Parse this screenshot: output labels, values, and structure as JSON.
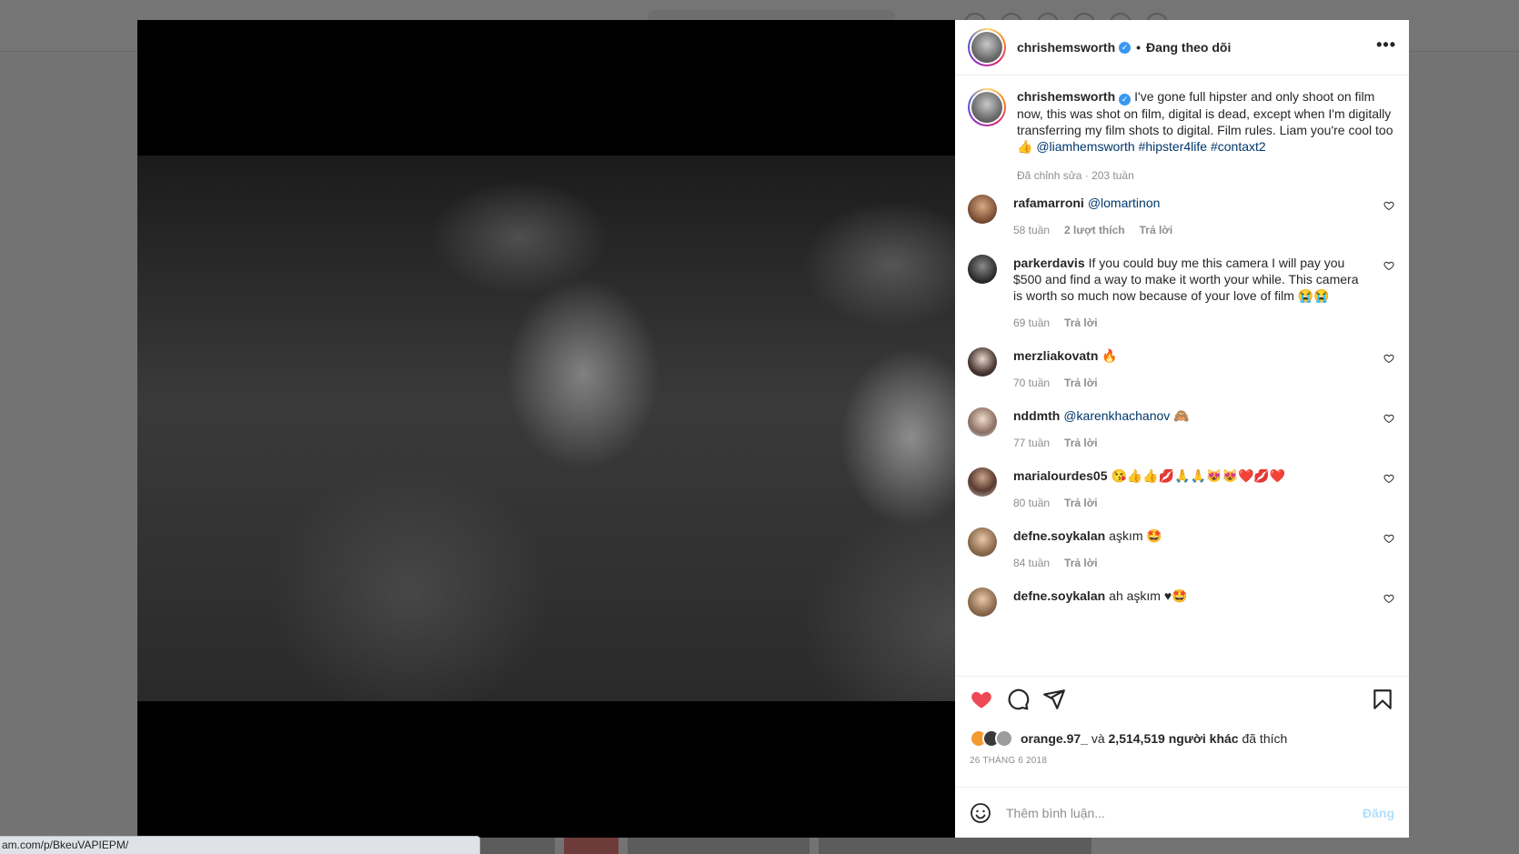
{
  "status_bar": {
    "url": "am.com/p/BkeuVAPIEPM/"
  },
  "post": {
    "author": "chrishemsworth",
    "follow_state": "Đang theo dõi",
    "separator": "•",
    "more": "•••",
    "caption": {
      "text": "I've gone full hipster and only shoot on film now, this was shot on film, digital is dead, except when I'm digitally transferring my film shots to digital. Film rules. Liam you're cool too 👍",
      "mention": "@liamhemsworth",
      "tags": "#hipster4life #contaxt2",
      "meta": "Đã chỉnh sửa · 203 tuần"
    },
    "reply_label": "Trả lời",
    "comments": [
      {
        "user": "rafamarroni",
        "link": "@lomartinon",
        "text": "",
        "time": "58 tuần",
        "likes": "2 lượt thích"
      },
      {
        "user": "parkerdavis",
        "link": "",
        "text": "If you could buy me this camera I will pay you $500 and find a way to make it worth your while. This camera is worth so much now because of your love of film 😭😭",
        "time": "69 tuần",
        "likes": ""
      },
      {
        "user": "merzliakovatn",
        "link": "",
        "text": "🔥",
        "time": "70 tuần",
        "likes": ""
      },
      {
        "user": "nddmth",
        "link": "@karenkhachanov",
        "text": "🙈",
        "time": "77 tuần",
        "likes": ""
      },
      {
        "user": "marialourdes05",
        "link": "",
        "text": "😘👍👍💋🙏🙏😻😻❤️💋❤️",
        "time": "80 tuần",
        "likes": ""
      },
      {
        "user": "defne.soykalan",
        "link": "",
        "text": "aşkım 🤩",
        "time": "84 tuần",
        "likes": ""
      },
      {
        "user": "defne.soykalan",
        "link": "",
        "text": "ah aşkım ♥🤩",
        "time": "",
        "likes": ""
      }
    ],
    "likes_line": {
      "first_liker": "orange.97_",
      "conjunction": "và",
      "others": "2,514,519 người khác",
      "suffix": "đã thích"
    },
    "date": "26 THÁNG 6 2018",
    "comment_input": {
      "placeholder": "Thêm bình luận...",
      "post_label": "Đăng"
    },
    "colors": {
      "like_red": "#ed4956",
      "link": "#00376b",
      "muted": "#8e8e8e",
      "post_disabled": "#b2dffc"
    }
  }
}
